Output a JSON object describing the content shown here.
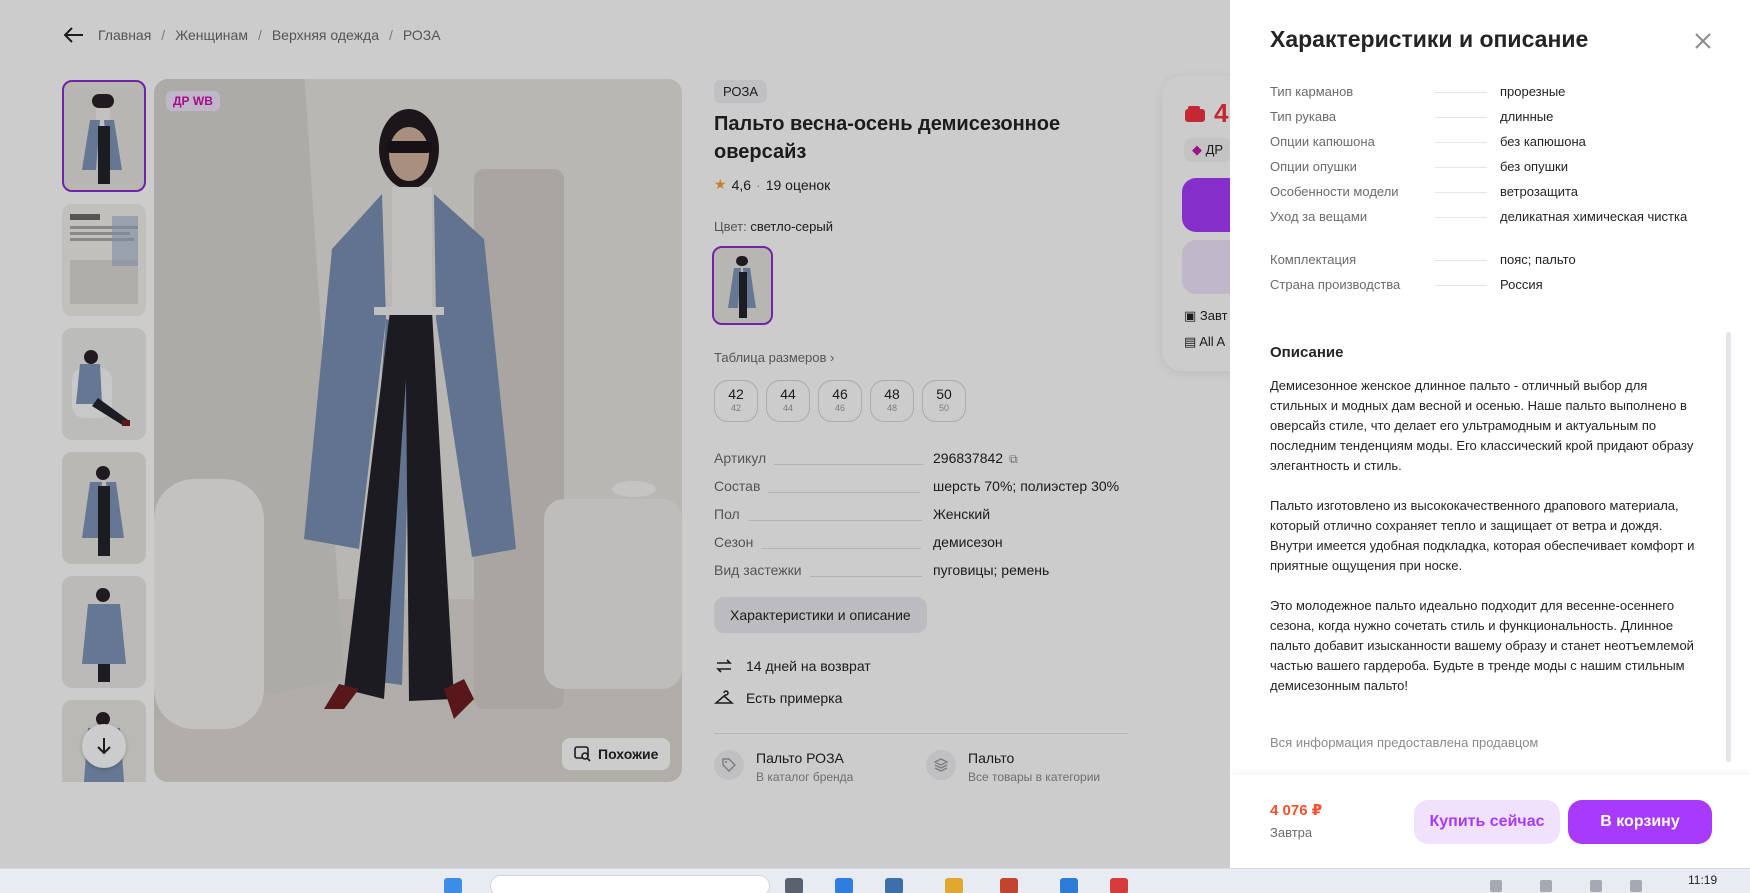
{
  "breadcrumbs": [
    "Главная",
    "Женщинам",
    "Верхняя одежда",
    "РОЗА"
  ],
  "product": {
    "photo_badge": "ДР WB",
    "similar_label": "Похожие",
    "brand": "РОЗА",
    "title": "Пальто весна-осень демисезонное оверсайз",
    "rating": "4,6",
    "reviews": "19 оценок",
    "color_label": "Цвет:",
    "color_value": "светло-серый",
    "size_table": "Таблица размеров",
    "sizes": [
      {
        "size": "42",
        "ru": "42"
      },
      {
        "size": "44",
        "ru": "44"
      },
      {
        "size": "46",
        "ru": "46"
      },
      {
        "size": "48",
        "ru": "48"
      },
      {
        "size": "50",
        "ru": "50"
      }
    ],
    "specs": [
      {
        "k": "Артикул",
        "v": "296837842"
      },
      {
        "k": "Состав",
        "v": "шерсть 70%; полиэстер 30%"
      },
      {
        "k": "Пол",
        "v": "Женский"
      },
      {
        "k": "Сезон",
        "v": "демисезон"
      },
      {
        "k": "Вид застежки",
        "v": "пуговицы; ремень"
      }
    ],
    "char_button": "Характеристики и описание",
    "return_policy": "14 дней на возврат",
    "fitting": "Есть примерка",
    "brand_card": {
      "title": "Пальто РОЗА",
      "sub": "В каталог бренда"
    },
    "category_card": {
      "title": "Пальто",
      "sub": "Все товары в категории"
    }
  },
  "buy_box": {
    "price_partial": "4",
    "chip_partial": "ДР",
    "line1_partial": "Завт",
    "line2_partial": "All A"
  },
  "panel": {
    "title": "Характеристики и описание",
    "specs": [
      {
        "k": "Тип карманов",
        "v": "прорезные"
      },
      {
        "k": "Тип рукава",
        "v": "длинные"
      },
      {
        "k": "Опции капюшона",
        "v": "без капюшона"
      },
      {
        "k": "Опции опушки",
        "v": "без опушки"
      },
      {
        "k": "Особенности модели",
        "v": "ветрозащита"
      },
      {
        "k": "Уход за вещами",
        "v": "деликатная химическая чистка"
      },
      {
        "k": "Комплектация",
        "v": "пояс; пальто"
      },
      {
        "k": "Страна производства",
        "v": "Россия"
      }
    ],
    "desc_title": "Описание",
    "paragraphs": [
      "Демисезонное женское длинное пальто - отличный выбор для стильных и модных дам весной и осенью. Наше пальто выполнено в оверсайз стиле, что делает его ультрамодным и актуальным по последним тенденциям моды. Его классический крой придают образу элегантность и стиль.",
      "Пальто изготовлено из высококачественного драпового материала, который отлично сохраняет тепло и защищает от ветра и дождя. Внутри имеется удобная подкладка, которая обеспечивает комфорт и приятные ощущения при носке.",
      "Это молодежное пальто идеально подходит для весенне-осеннего сезона, когда нужно сочетать стиль и функциональность. Длинное пальто добавит изысканности вашему образу и станет неотъемлемой частью вашего гардероба. Будьте в тренде моды с нашим стильным демисезонным пальто!"
    ],
    "seller_note": "Вся информация предоставлена продавцом",
    "price": "4 076 ₽",
    "delivery": "Завтра",
    "buy_now": "Купить сейчас",
    "to_cart": "В корзину"
  },
  "taskbar": {
    "time": "11:19"
  },
  "colors": {
    "accent": "#a73afd",
    "price": "#f2512e",
    "badge": "#cb11ab",
    "selected_outline": "#8d2fd1"
  }
}
